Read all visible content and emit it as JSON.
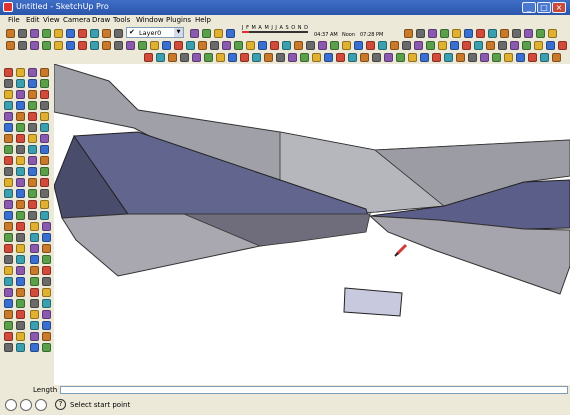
{
  "window": {
    "title": "Untitled - SketchUp Pro",
    "minimize_glyph": "_",
    "maximize_glyph": "□",
    "close_glyph": "×"
  },
  "menu": [
    "File",
    "Edit",
    "View",
    "Camera",
    "Draw",
    "Tools",
    "Window",
    "Plugins",
    "Help"
  ],
  "layers": {
    "current": "Layer0",
    "check_glyph": "✔",
    "arrow_glyph": "▼"
  },
  "shadow": {
    "months": "J F M A M J J A S O N D",
    "time_start": "04:37 AM",
    "noon": "Noon",
    "time_end": "07:28 PM"
  },
  "measurements": {
    "label": "Length",
    "value": ""
  },
  "status": {
    "help_glyph": "?",
    "text": "Select start point"
  },
  "colors": {
    "titlebar": "#2a55aa",
    "chrome": "#ece9d8",
    "face_front": "#a9a7b0",
    "face_back": "#575a7e",
    "pencil_cursor": "#d33a3a"
  },
  "icons": {
    "app": "sketchup-logo-icon",
    "select": "arrow-select-icon",
    "pencil": "pencil-icon",
    "status_left": "geolocation-icon",
    "status_mid": "credits-icon",
    "status_right": "user-icon",
    "help": "help-icon"
  }
}
